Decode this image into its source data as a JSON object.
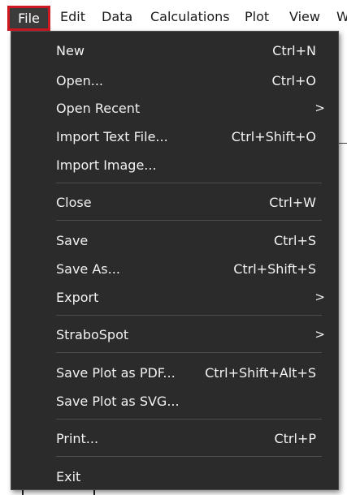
{
  "menubar": {
    "items": [
      "File",
      "Edit",
      "Data",
      "Calculations",
      "Plot",
      "View",
      "W"
    ]
  },
  "file_menu": {
    "items": [
      {
        "label": "New",
        "shortcut": "Ctrl+N"
      },
      {
        "label": "Open...",
        "shortcut": "Ctrl+O"
      },
      {
        "label": "Open Recent",
        "submenu_arrow": ">"
      },
      {
        "label": "Import Text File...",
        "shortcut": "Ctrl+Shift+O"
      },
      {
        "label": "Import Image..."
      },
      {
        "label": "Close",
        "shortcut": "Ctrl+W"
      },
      {
        "label": "Save",
        "shortcut": "Ctrl+S"
      },
      {
        "label": "Save As...",
        "shortcut": "Ctrl+Shift+S"
      },
      {
        "label": "Export",
        "submenu_arrow": ">"
      },
      {
        "label": "StraboSpot",
        "submenu_arrow": ">"
      },
      {
        "label": "Save Plot as PDF...",
        "shortcut": "Ctrl+Shift+Alt+S"
      },
      {
        "label": "Save Plot as SVG..."
      },
      {
        "label": "Print...",
        "shortcut": "Ctrl+P"
      },
      {
        "label": "Exit"
      }
    ]
  },
  "colors": {
    "menu_background": "#2b2b2b",
    "menu_text": "#f2f2f2",
    "separator": "#4d4d4d",
    "active_tab_background": "#3b3b3b",
    "highlight_border": "#d01822"
  }
}
